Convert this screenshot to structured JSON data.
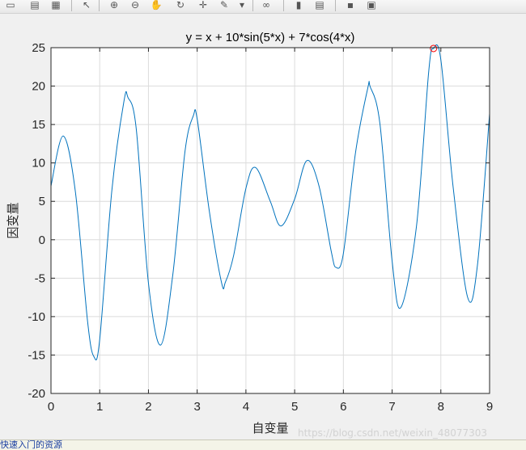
{
  "toolbar": {
    "buttons": [
      {
        "name": "new-figure-icon",
        "glyph": "▭"
      },
      {
        "name": "open-file-icon",
        "glyph": "▤"
      },
      {
        "name": "save-icon",
        "glyph": "▦"
      },
      {
        "name": "pointer-icon",
        "glyph": "↖"
      },
      {
        "name": "zoom-in-icon",
        "glyph": "⊕"
      },
      {
        "name": "zoom-out-icon",
        "glyph": "⊖"
      },
      {
        "name": "pan-icon",
        "glyph": "✋"
      },
      {
        "name": "rotate-icon",
        "glyph": "↻"
      },
      {
        "name": "data-cursor-icon",
        "glyph": "✛"
      },
      {
        "name": "brush-icon",
        "glyph": "✎"
      },
      {
        "name": "brush-dropdown-icon",
        "glyph": "▾"
      },
      {
        "name": "link-icon",
        "glyph": "∞"
      },
      {
        "name": "colorbar-icon",
        "glyph": "▮"
      },
      {
        "name": "legend-icon",
        "glyph": "▤"
      },
      {
        "name": "hide-tools-icon",
        "glyph": "▪"
      },
      {
        "name": "dock-icon",
        "glyph": "▣"
      }
    ]
  },
  "chart_data": {
    "type": "line",
    "title": "y = x + 10*sin(5*x) + 7*cos(4*x)",
    "xlabel": "自变量",
    "ylabel": "因变量",
    "xlim": [
      0,
      9
    ],
    "ylim": [
      -20,
      25
    ],
    "xticks": [
      0,
      1,
      2,
      3,
      4,
      5,
      6,
      7,
      8,
      9
    ],
    "yticks": [
      -20,
      -15,
      -10,
      -5,
      0,
      5,
      10,
      15,
      20,
      25
    ],
    "grid": true,
    "line_color": "#0072bd",
    "marker_color": "#ff0000",
    "series": [
      {
        "x": [
          0,
          0.25,
          0.5,
          0.75,
          0.88,
          1.0,
          1.25,
          1.5,
          1.58,
          1.75,
          2.0,
          2.25,
          2.5,
          2.75,
          2.92,
          3.0,
          3.25,
          3.5,
          3.58,
          3.75,
          4.0,
          4.2,
          4.5,
          4.72,
          5.0,
          5.25,
          5.5,
          5.75,
          5.85,
          6.0,
          6.25,
          6.5,
          6.55,
          6.75,
          7.0,
          7.18,
          7.5,
          7.75,
          7.85,
          8.0,
          8.25,
          8.55,
          8.75,
          9.0
        ],
        "y": [
          7.0,
          13.5,
          6.3,
          -10.6,
          -15.2,
          -13.0,
          6.5,
          18.1,
          18.5,
          14.4,
          -5.6,
          -13.7,
          -4.5,
          11.5,
          16.1,
          15.7,
          3.7,
          -5.6,
          -5.5,
          -2.0,
          6.7,
          9.4,
          5.0,
          1.8,
          5.3,
          10.3,
          7.0,
          -1.5,
          -3.6,
          -1.8,
          11.4,
          19.7,
          19.9,
          15.1,
          -2.8,
          -8.8,
          1.8,
          21.8,
          24.9,
          23.4,
          7.0,
          -7.5,
          -3.4,
          16.4
        ]
      }
    ],
    "markers": [
      {
        "x": 7.85,
        "y": 24.9,
        "shape": "circle"
      }
    ]
  },
  "watermark": "https://blog.csdn.net/weixin_48077303",
  "status_text": "快速入门的资源"
}
